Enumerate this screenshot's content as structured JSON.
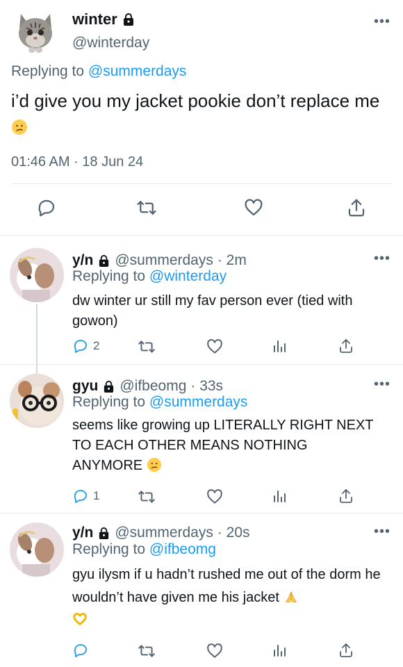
{
  "main": {
    "name": "winter",
    "handle": "@winterday",
    "replying_prefix": "Replying to",
    "replying_to": "@summerdays",
    "text": "i’d give you my jacket pookie don’t replace me",
    "timestamp": "01:46 AM · 18 Jun 24"
  },
  "replies": [
    {
      "name": "y/n",
      "handle": "@summerdays",
      "time": "· 2m",
      "replying_prefix": "Replying to",
      "replying_to": "@winterday",
      "text": "dw winter ur still my fav person ever (tied with gowon)",
      "reply_count": "2"
    },
    {
      "name": "gyu",
      "handle": "@ifbeomg",
      "time": "· 33s",
      "replying_prefix": "Replying to",
      "replying_to": "@summerdays",
      "text": "seems like growing up LITERALLY RIGHT NEXT TO EACH OTHER MEANS NOTHING ANYMORE",
      "reply_count": "1"
    },
    {
      "name": "y/n",
      "handle": "@summerdays",
      "time": "· 20s",
      "replying_prefix": "Replying to",
      "replying_to": "@ifbeomg",
      "text": "gyu ilysm if u hadn’t rushed me out of the dorm he wouldn’t have given me his jacket",
      "reply_count": ""
    }
  ],
  "icons": {
    "lock": "lock-icon",
    "reply": "reply-icon",
    "retweet": "retweet-icon",
    "like": "heart-icon",
    "views": "views-icon",
    "share": "share-icon",
    "more": "more-icon"
  },
  "colors": {
    "link": "#1d9bf0",
    "muted": "#536471",
    "text": "#0f1419",
    "divider": "#e6e9eb"
  }
}
